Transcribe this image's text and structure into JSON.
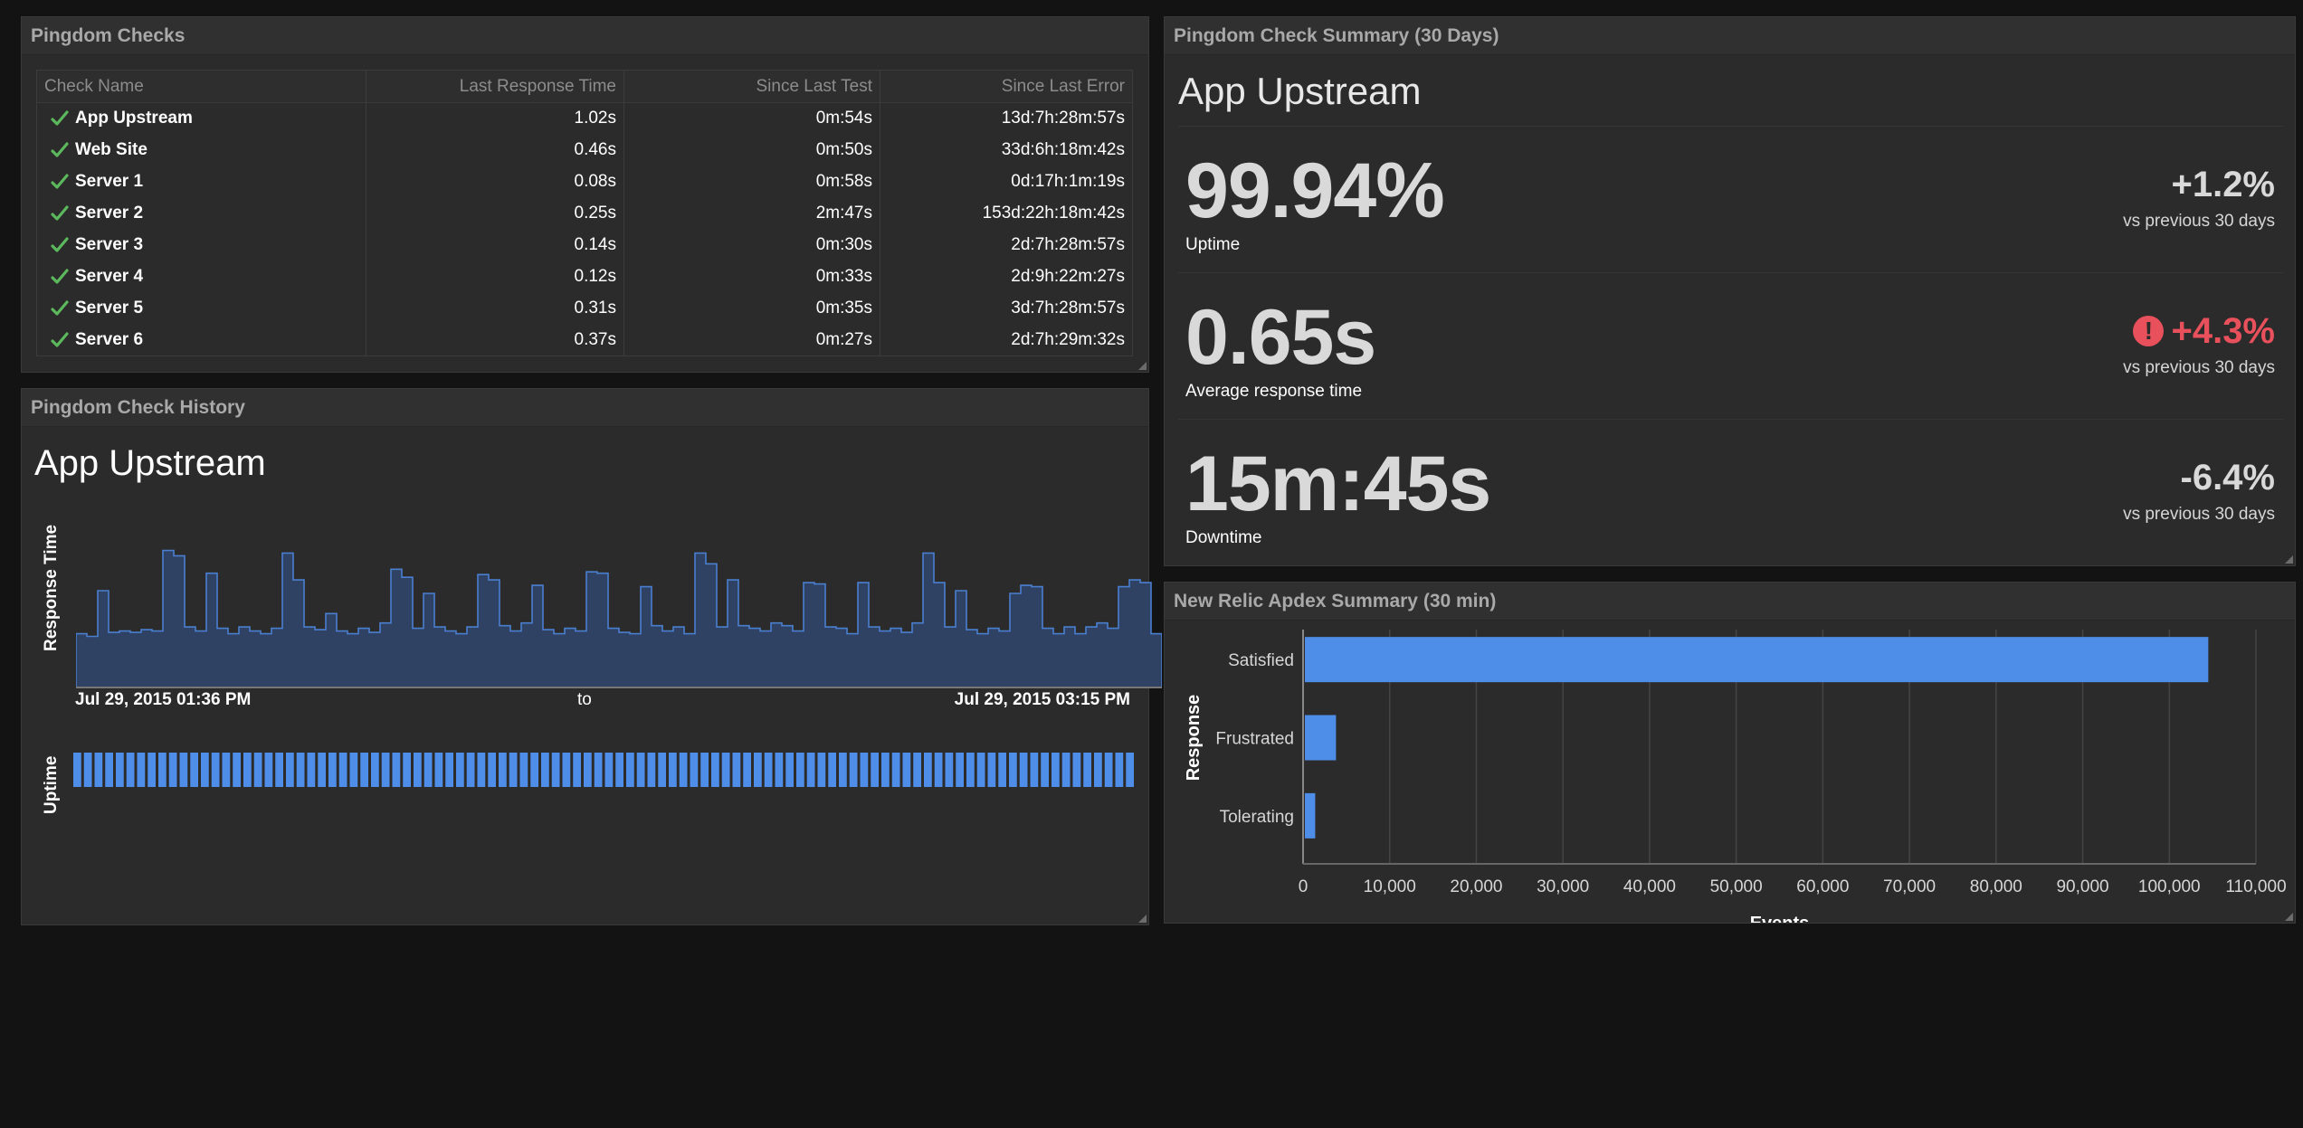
{
  "checks_panel": {
    "title": "Pingdom Checks",
    "columns": [
      "Check Name",
      "Last Response Time",
      "Since Last Test",
      "Since Last Error"
    ],
    "rows": [
      {
        "name": "App Upstream",
        "response": "1.02s",
        "since_test": "0m:54s",
        "since_error": "13d:7h:28m:57s"
      },
      {
        "name": "Web Site",
        "response": "0.46s",
        "since_test": "0m:50s",
        "since_error": "33d:6h:18m:42s"
      },
      {
        "name": "Server 1",
        "response": "0.08s",
        "since_test": "0m:58s",
        "since_error": "0d:17h:1m:19s"
      },
      {
        "name": "Server 2",
        "response": "0.25s",
        "since_test": "2m:47s",
        "since_error": "153d:22h:18m:42s"
      },
      {
        "name": "Server 3",
        "response": "0.14s",
        "since_test": "0m:30s",
        "since_error": "2d:7h:28m:57s"
      },
      {
        "name": "Server 4",
        "response": "0.12s",
        "since_test": "0m:33s",
        "since_error": "2d:9h:22m:27s"
      },
      {
        "name": "Server 5",
        "response": "0.31s",
        "since_test": "0m:35s",
        "since_error": "3d:7h:28m:57s"
      },
      {
        "name": "Server 6",
        "response": "0.37s",
        "since_test": "0m:27s",
        "since_error": "2d:7h:29m:32s"
      }
    ],
    "status_color": "#5cb85c"
  },
  "history_panel": {
    "title": "Pingdom Check History",
    "check_name": "App Upstream",
    "y_label_response": "Response Time",
    "y_label_uptime": "Uptime",
    "range_start": "Jul 29, 2015 01:36 PM",
    "range_to": "to",
    "range_end": "Jul 29, 2015 03:15 PM",
    "uptime_color": "#4f8ee8",
    "line_color": "#4a7fd0"
  },
  "summary_panel": {
    "title": "Pingdom Check Summary (30 Days)",
    "check_name": "App Upstream",
    "metrics": [
      {
        "value": "99.94%",
        "label": "Uptime",
        "delta": "+1.2%",
        "delta_sub": "vs previous 30 days"
      },
      {
        "value": "0.65s",
        "label": "Average response time",
        "delta": "+4.3%",
        "delta_sub": "vs previous 30 days"
      },
      {
        "value": "15m:45s",
        "label": "Downtime",
        "delta": "-6.4%",
        "delta_sub": "vs previous 30 days"
      }
    ],
    "alert_icon": "!",
    "alert_color": "#e8505b"
  },
  "apdex_panel": {
    "title": "New Relic Apdex Summary (30 min)"
  },
  "chart_data": [
    {
      "type": "area",
      "title": "",
      "ylabel": "Response Time",
      "x": [],
      "values": [
        0.4,
        0.38,
        0.72,
        0.41,
        0.42,
        0.41,
        0.43,
        0.42,
        1.02,
        0.98,
        0.45,
        0.42,
        0.85,
        0.44,
        0.4,
        0.45,
        0.42,
        0.4,
        0.44,
        1.0,
        0.8,
        0.45,
        0.43,
        0.55,
        0.42,
        0.4,
        0.44,
        0.41,
        0.48,
        0.88,
        0.82,
        0.44,
        0.7,
        0.45,
        0.42,
        0.4,
        0.45,
        0.84,
        0.8,
        0.46,
        0.42,
        0.48,
        0.76,
        0.43,
        0.4,
        0.44,
        0.42,
        0.86,
        0.85,
        0.44,
        0.41,
        0.4,
        0.75,
        0.46,
        0.42,
        0.45,
        0.4,
        1.0,
        0.92,
        0.45,
        0.8,
        0.46,
        0.44,
        0.42,
        0.48,
        0.46,
        0.42,
        0.78,
        0.77,
        0.45,
        0.44,
        0.4,
        0.78,
        0.45,
        0.42,
        0.44,
        0.41,
        0.48,
        1.0,
        0.78,
        0.45,
        0.72,
        0.43,
        0.4,
        0.44,
        0.42,
        0.7,
        0.76,
        0.75,
        0.44,
        0.4,
        0.45,
        0.4,
        0.45,
        0.48,
        0.44,
        0.75,
        0.8,
        0.78,
        0.4
      ]
    },
    {
      "type": "bar",
      "title": "",
      "categories": [
        "Satisfied",
        "Frustrated",
        "Tolerating"
      ],
      "values": [
        104500,
        3800,
        1400
      ],
      "xlabel": "Events",
      "ylabel": "Response",
      "xlim": [
        0,
        110000
      ],
      "xticks": [
        "0",
        "10,000",
        "20,000",
        "30,000",
        "40,000",
        "50,000",
        "60,000",
        "70,000",
        "80,000",
        "90,000",
        "100,000",
        "110,000"
      ],
      "bar_color": "#4f8ee8",
      "grid": true
    }
  ]
}
